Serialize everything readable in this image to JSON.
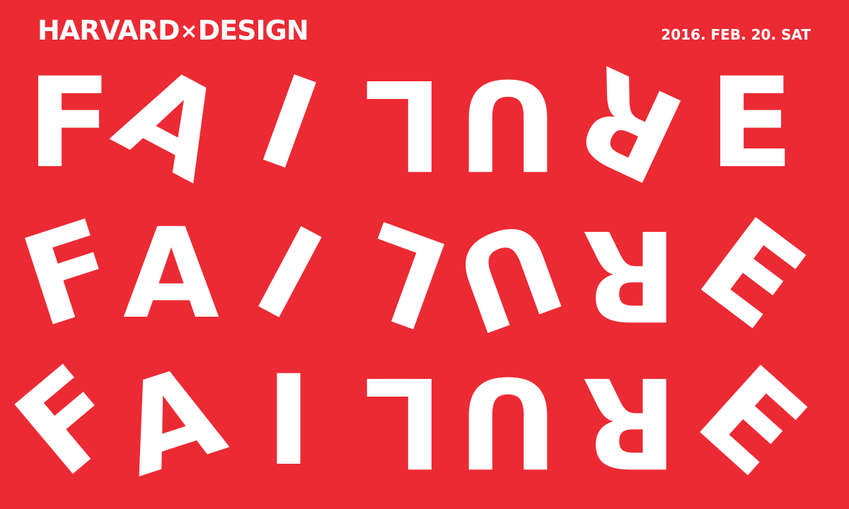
{
  "header": {
    "brand_left": "HARVARD",
    "brand_sep": "×",
    "brand_right": "DESIGN",
    "date": "2016. FEB. 20. SAT"
  },
  "rows": [
    {
      "letters": [
        "F",
        "A",
        "I",
        "L",
        "U",
        "R",
        "E"
      ],
      "rotations": [
        0,
        28,
        20,
        180,
        180,
        205,
        0
      ]
    },
    {
      "letters": [
        "F",
        "A",
        "I",
        "L",
        "U",
        "R",
        "E"
      ],
      "rotations": [
        -18,
        0,
        28,
        200,
        160,
        180,
        37
      ]
    },
    {
      "letters": [
        "F",
        "A",
        "I",
        "L",
        "U",
        "R",
        "E"
      ],
      "rotations": [
        -40,
        -18,
        0,
        180,
        180,
        180,
        42
      ]
    }
  ],
  "colors": {
    "background": "#ec2a33",
    "foreground": "#ffffff"
  }
}
